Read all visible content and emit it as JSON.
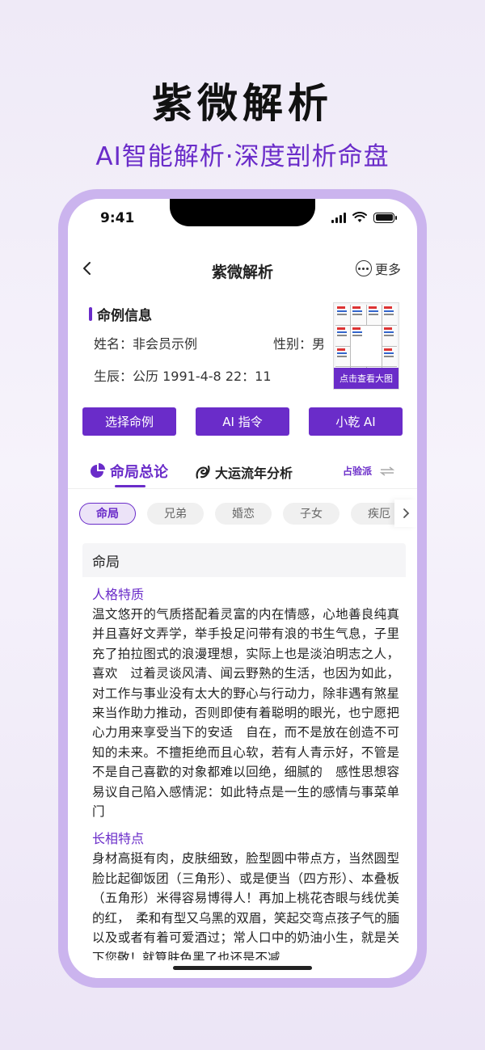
{
  "hero": {
    "title": "紫微解析",
    "subtitle": "AI智能解析·深度剖析命盘"
  },
  "status_bar": {
    "time": "9:41"
  },
  "nav": {
    "title": "紫微解析",
    "more_label": "更多",
    "back_icon": "chevron-left-icon",
    "more_icon": "ellipsis-circle-icon"
  },
  "info": {
    "section_title": "命例信息",
    "name_label": "姓名：",
    "name_value": "非会员示例",
    "gender_label": "性别：",
    "gender_value": "男",
    "birth_label": "生辰：",
    "birth_value": "公历 1991-4-8 22：11",
    "view_chart_label": "点击查看大图"
  },
  "buttons": {
    "select_case": "选择命例",
    "ai_command": "AI 指令",
    "xiaoqian_ai": "小乾 AI"
  },
  "tabs": {
    "tab1": "命局总论",
    "tab2": "大运流年分析",
    "school": "占验派"
  },
  "chips": [
    "命局",
    "兄弟",
    "婚恋",
    "子女",
    "疾厄"
  ],
  "content": {
    "card_title": "命局",
    "sections": [
      {
        "title": "人格特质",
        "text": "温文悠开的气质搭配着灵富的内在情感，心地善良纯真并且喜好文弄学，举手投足问带有浪的书生气息，子里充了拍拉图式的浪漫理想，实际上也是淡泊明志之人，喜欢　过着灵谈风清、闻云野熟的生活，也因为如此，对工作与事业没有太大的野心与行动力，除非遇有煞星来当作助力推动，否则即使有着聪明的眼光，也宁愿把心力用来享受当下的安适　自在，而不是放在创造不可知的未来。不擅拒绝而且心软，若有人青示好，不管是不是自己喜歡的对象都难以回绝，细腻的　感性思想容易议自己陷入感情泥：如此特点是一生的感情与事菜单门"
      },
      {
        "title": "长相特点",
        "text": "身材高挺有肉，皮肤细致，脸型圆中带点方，当然圆型脸比起御饭团（三角形）、或是便当（四方形）、本叠板（五角形）米得容易博得人！再加上桃花杏眼与线优美的红，　柔和有型又乌黑的双眉，笑起交弯点孩子气的腼以及或者有着可爱酒过；常人口中的奶油小生，就是关下您敬！就算肤色黑了也还是不减"
      }
    ]
  },
  "colors": {
    "accent": "#6a2cc9",
    "phone_frame": "#cbb4ee"
  }
}
